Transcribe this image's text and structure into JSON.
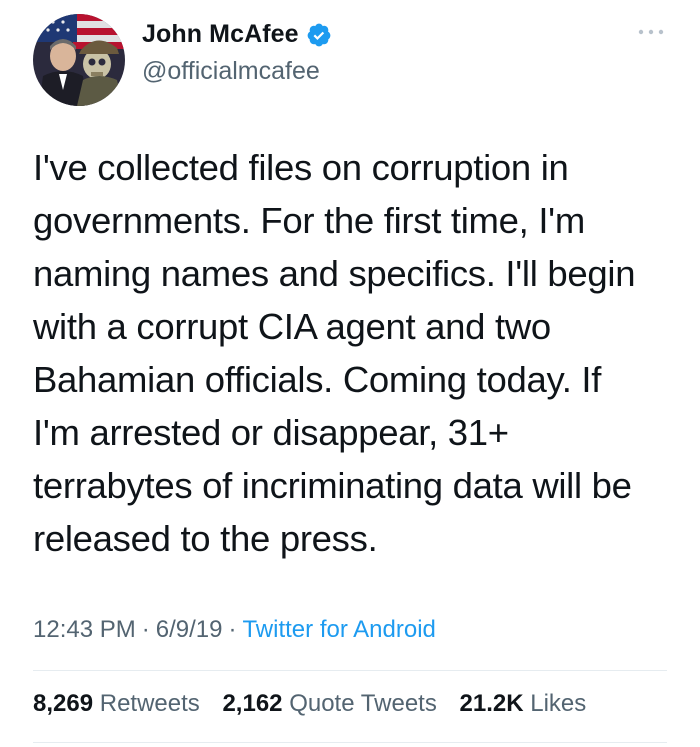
{
  "author": {
    "display_name": "John McAfee",
    "handle": "@officialmcafee",
    "verified": true
  },
  "tweet": {
    "text_lines": [
      "I've collected files on corruption in",
      "governments. For the first time, I'm",
      "naming names and specifics. I'll begin",
      "with a corrupt CIA agent and two",
      "Bahamian officials. Coming today. If",
      "I'm arrested or disappear, 31+",
      "terrabytes of incriminating data will be",
      "released to the press."
    ],
    "time": "12:43 PM",
    "date": "6/9/19",
    "separator": "·",
    "source": "Twitter for Android"
  },
  "stats": {
    "retweets": {
      "count": "8,269",
      "label": "Retweets"
    },
    "quote_tweets": {
      "count": "2,162",
      "label": "Quote Tweets"
    },
    "likes": {
      "count": "21.2K",
      "label": "Likes"
    }
  },
  "icons": {
    "verified": "verified-badge-icon",
    "more": "more-options-icon",
    "avatar": "profile-avatar"
  },
  "colors": {
    "text": "#0f1419",
    "secondary": "#536471",
    "link": "#1d9bf0",
    "divider": "#e6ecf0"
  }
}
